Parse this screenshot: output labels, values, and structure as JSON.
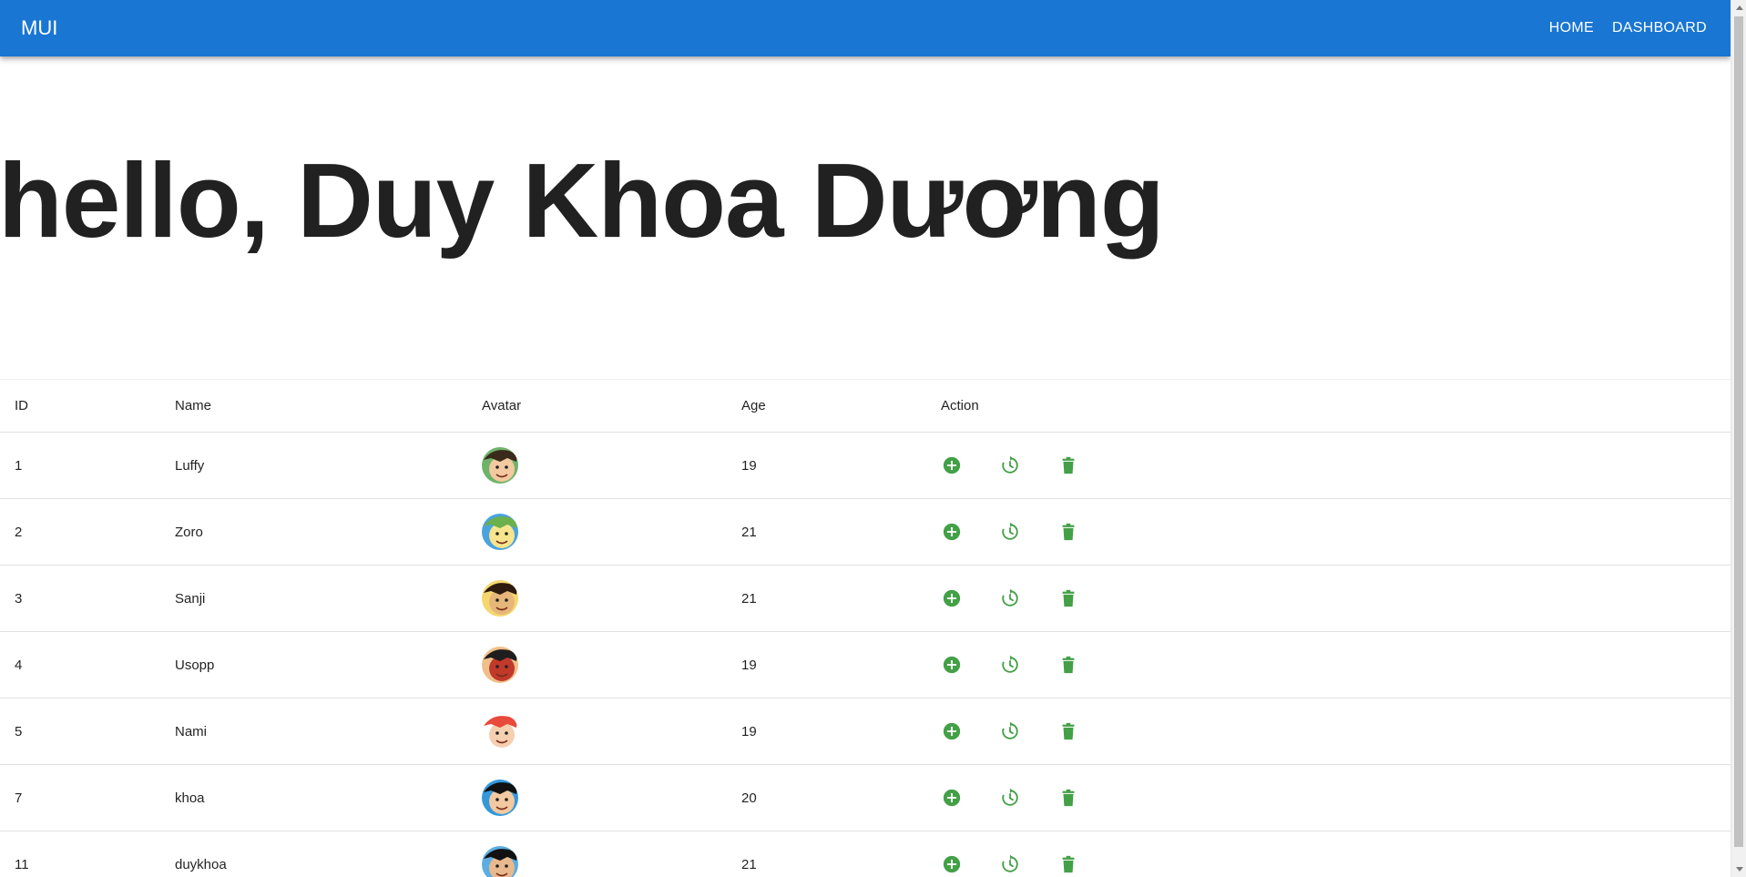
{
  "appbar": {
    "brand": "MUI",
    "nav": [
      {
        "label": "HOME"
      },
      {
        "label": "DASHBOARD"
      }
    ]
  },
  "hero": {
    "greeting": "hello, Duy Khoa Dương"
  },
  "table": {
    "headers": [
      "ID",
      "Name",
      "Avatar",
      "Age",
      "Action"
    ],
    "rows": [
      {
        "id": "1",
        "name": "Luffy",
        "age": "19"
      },
      {
        "id": "2",
        "name": "Zoro",
        "age": "21"
      },
      {
        "id": "3",
        "name": "Sanji",
        "age": "21"
      },
      {
        "id": "4",
        "name": "Usopp",
        "age": "19"
      },
      {
        "id": "5",
        "name": "Nami",
        "age": "19"
      },
      {
        "id": "7",
        "name": "khoa",
        "age": "20"
      },
      {
        "id": "11",
        "name": "duykhoa",
        "age": "21"
      }
    ]
  },
  "colors": {
    "primary": "#1976d2",
    "action_green": "#43a047"
  },
  "icons": {
    "add": "add-circle-icon",
    "update": "restore-icon",
    "delete": "trash-icon"
  }
}
